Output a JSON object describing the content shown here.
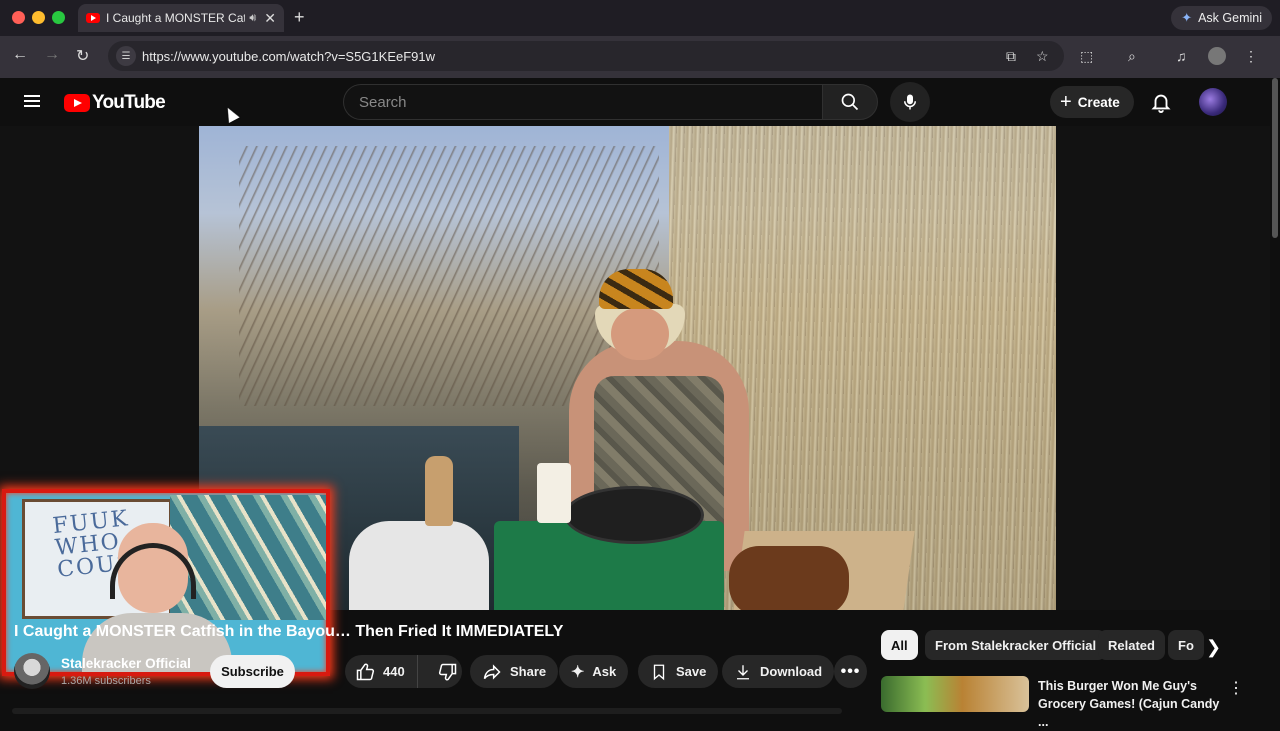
{
  "browser": {
    "tab_title": "I Caught a MONSTER Catf",
    "new_tab_symbol": "+",
    "ask_gemini": "Ask Gemini",
    "url": "https://www.youtube.com/watch?v=S5G1KEeF91w"
  },
  "masthead": {
    "logo_text": "YouTube",
    "search_placeholder": "Search",
    "create_label": "Create"
  },
  "video": {
    "title": "I Caught a MONSTER Catfish in the Bayou… Then Fried It IMMEDIATELY",
    "webcam_board_text": "FUUK\nWHO\nCOUS"
  },
  "channel": {
    "name": "Stalekracker Official",
    "subscribers": "1.36M subscribers",
    "subscribe_label": "Subscribe"
  },
  "actions": {
    "like_count": "440",
    "share": "Share",
    "ask": "Ask",
    "save": "Save",
    "download": "Download",
    "more": "•••"
  },
  "chips": [
    "All",
    "From Stalekracker Official",
    "Related",
    "Fo"
  ],
  "recommended": {
    "title": "This Burger Won Me Guy's Grocery Games! (Cajun Candy ..."
  },
  "colors": {
    "youtube_red": "#ff0000",
    "background": "#0f0f0f",
    "webcam_border": "#d81a10"
  }
}
